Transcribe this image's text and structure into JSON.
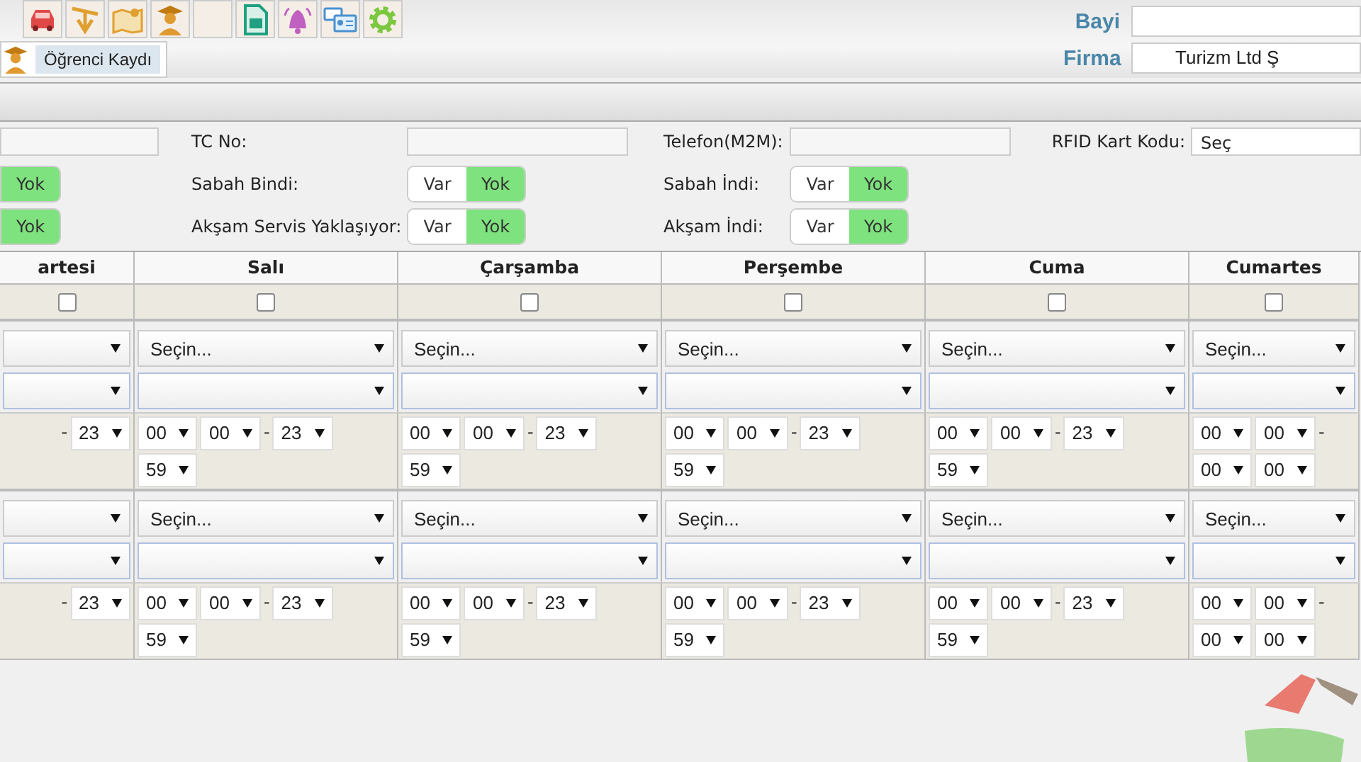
{
  "header": {
    "fields": [
      {
        "label": "Bayi"
      },
      {
        "label": "Firma",
        "value": "Turizm Ltd Ş"
      }
    ]
  },
  "tabs": [
    {
      "label": "Öğrenci Kaydı",
      "selected": true
    }
  ],
  "form": {
    "rows": [
      [
        {
          "kind": "input"
        },
        {
          "kind": "input",
          "label": "TC No:"
        },
        {
          "kind": "input",
          "label": "Telefon(M2M):"
        },
        {
          "kind": "select",
          "label": "RFID Kart Kodu:",
          "value": "Seç"
        }
      ],
      [
        {
          "kind": "toggle",
          "options": [
            {
              "label": "Yok",
              "selected": true
            }
          ]
        },
        {
          "kind": "toggle",
          "label": "Sabah Bindi:",
          "options": [
            {
              "label": "Var",
              "selected": false
            },
            {
              "label": "Yok",
              "selected": true
            }
          ]
        },
        {
          "kind": "toggle",
          "label": "Sabah İndi:",
          "options": [
            {
              "label": "Var",
              "selected": false
            },
            {
              "label": "Yok",
              "selected": true
            }
          ]
        }
      ],
      [
        {
          "kind": "toggle",
          "options": [
            {
              "label": "Yok",
              "selected": true
            }
          ]
        },
        {
          "kind": "toggle",
          "label": "Akşam Servis Yaklaşıyor:",
          "options": [
            {
              "label": "Var",
              "selected": false
            },
            {
              "label": "Yok",
              "selected": true
            }
          ]
        },
        {
          "kind": "toggle",
          "label": "Akşam İndi:",
          "options": [
            {
              "label": "Var",
              "selected": false
            },
            {
              "label": "Yok",
              "selected": true
            }
          ]
        }
      ]
    ]
  },
  "schedule": {
    "days": [
      {
        "name": "artesi",
        "checked": false
      },
      {
        "name": "Salı",
        "checked": false
      },
      {
        "name": "Çarşamba",
        "checked": false
      },
      {
        "name": "Perşembe",
        "checked": false
      },
      {
        "name": "Cuma",
        "checked": false
      },
      {
        "name": "Cumartes",
        "checked": false
      }
    ],
    "blocks": [
      {
        "cells": [
          {
            "times": [
              {
                "kind": "dash",
                "text": "-"
              },
              {
                "kind": "select",
                "value": "23"
              }
            ]
          },
          {
            "route": "Seçin...",
            "times": [
              {
                "kind": "select",
                "value": "00"
              },
              {
                "kind": "select",
                "value": "00"
              },
              {
                "kind": "dash",
                "text": "-"
              },
              {
                "kind": "select",
                "value": "23"
              },
              {
                "kind": "select",
                "value": "59"
              }
            ]
          },
          {
            "route": "Seçin...",
            "times": [
              {
                "kind": "select",
                "value": "00"
              },
              {
                "kind": "select",
                "value": "00"
              },
              {
                "kind": "dash",
                "text": "-"
              },
              {
                "kind": "select",
                "value": "23"
              },
              {
                "kind": "select",
                "value": "59"
              }
            ]
          },
          {
            "route": "Seçin...",
            "times": [
              {
                "kind": "select",
                "value": "00"
              },
              {
                "kind": "select",
                "value": "00"
              },
              {
                "kind": "dash",
                "text": "-"
              },
              {
                "kind": "select",
                "value": "23"
              },
              {
                "kind": "select",
                "value": "59"
              }
            ]
          },
          {
            "route": "Seçin...",
            "times": [
              {
                "kind": "select",
                "value": "00"
              },
              {
                "kind": "select",
                "value": "00"
              },
              {
                "kind": "dash",
                "text": "-"
              },
              {
                "kind": "select",
                "value": "23"
              },
              {
                "kind": "select",
                "value": "59"
              }
            ]
          },
          {
            "route": "Seçin...",
            "times": [
              {
                "kind": "select",
                "value": "00"
              },
              {
                "kind": "select",
                "value": "00"
              },
              {
                "kind": "dash",
                "text": "-"
              },
              {
                "kind": "select",
                "value": "00"
              },
              {
                "kind": "select",
                "value": "00"
              }
            ]
          }
        ]
      },
      {
        "cells": [
          {
            "times": [
              {
                "kind": "dash",
                "text": "-"
              },
              {
                "kind": "select",
                "value": "23"
              }
            ]
          },
          {
            "route": "Seçin...",
            "times": [
              {
                "kind": "select",
                "value": "00"
              },
              {
                "kind": "select",
                "value": "00"
              },
              {
                "kind": "dash",
                "text": "-"
              },
              {
                "kind": "select",
                "value": "23"
              },
              {
                "kind": "select",
                "value": "59"
              }
            ]
          },
          {
            "route": "Seçin...",
            "times": [
              {
                "kind": "select",
                "value": "00"
              },
              {
                "kind": "select",
                "value": "00"
              },
              {
                "kind": "dash",
                "text": "-"
              },
              {
                "kind": "select",
                "value": "23"
              },
              {
                "kind": "select",
                "value": "59"
              }
            ]
          },
          {
            "route": "Seçin...",
            "times": [
              {
                "kind": "select",
                "value": "00"
              },
              {
                "kind": "select",
                "value": "00"
              },
              {
                "kind": "dash",
                "text": "-"
              },
              {
                "kind": "select",
                "value": "23"
              },
              {
                "kind": "select",
                "value": "59"
              }
            ]
          },
          {
            "route": "Seçin...",
            "times": [
              {
                "kind": "select",
                "value": "00"
              },
              {
                "kind": "select",
                "value": "00"
              },
              {
                "kind": "dash",
                "text": "-"
              },
              {
                "kind": "select",
                "value": "23"
              },
              {
                "kind": "select",
                "value": "59"
              }
            ]
          },
          {
            "route": "Seçin...",
            "times": [
              {
                "kind": "select",
                "value": "00"
              },
              {
                "kind": "select",
                "value": "00"
              },
              {
                "kind": "dash",
                "text": "-"
              },
              {
                "kind": "select",
                "value": "00"
              },
              {
                "kind": "select",
                "value": "00"
              }
            ]
          }
        ]
      }
    ]
  }
}
